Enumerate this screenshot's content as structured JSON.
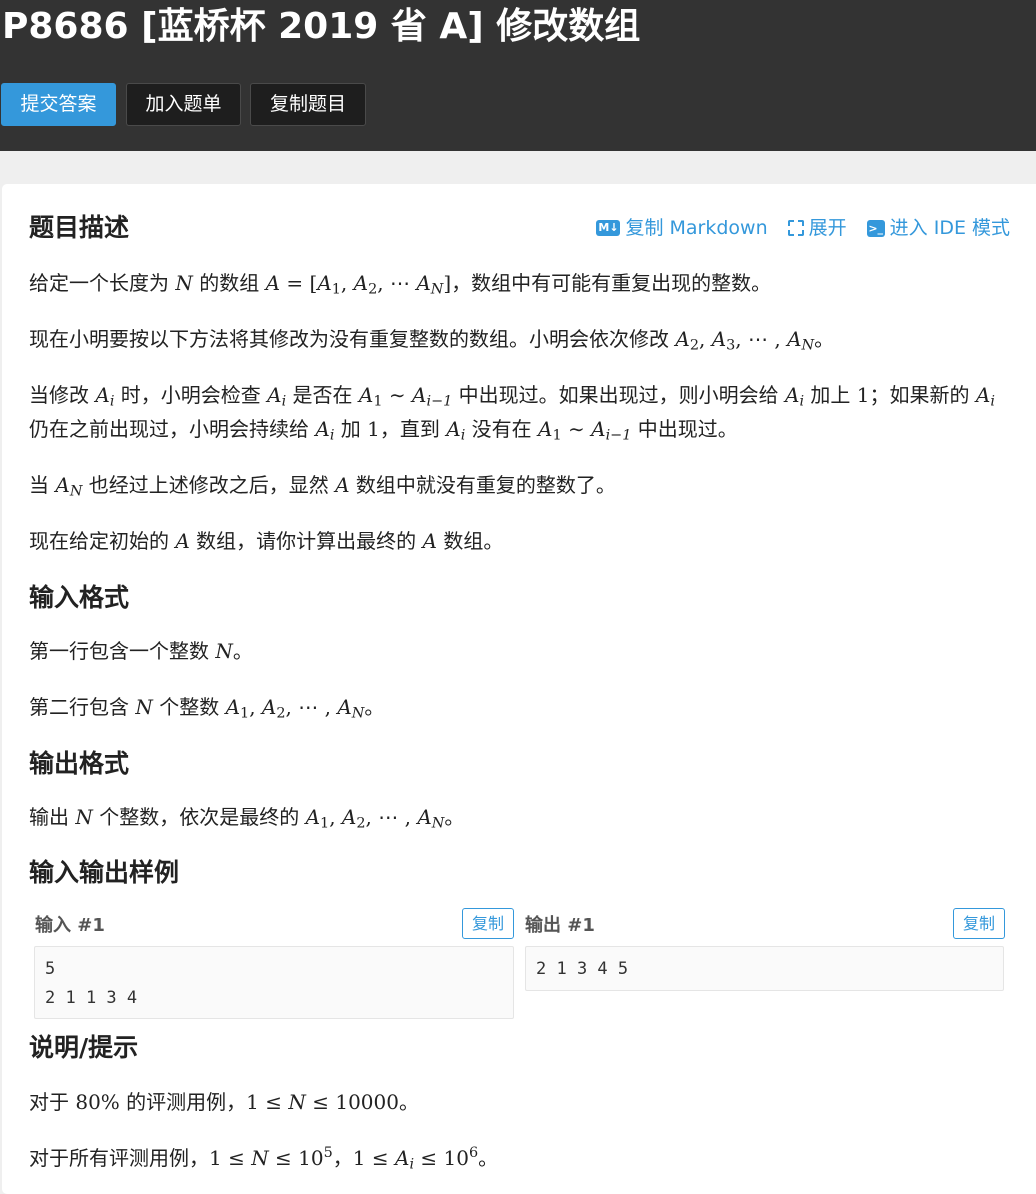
{
  "header": {
    "title": "P8686 [蓝桥杯 2019 省 A] 修改数组",
    "buttons": {
      "submit": "提交答案",
      "add_list": "加入题单",
      "copy_problem": "复制题目"
    }
  },
  "tools": {
    "copy_markdown": "复制 Markdown",
    "expand": "展开",
    "ide_mode": "进入 IDE 模式",
    "md_badge": "M↓",
    "ide_badge": ">_"
  },
  "sections": {
    "description": "题目描述",
    "input_format": "输入格式",
    "output_format": "输出格式",
    "samples": "输入输出样例",
    "hints": "说明/提示"
  },
  "samples": {
    "input_label": "输入 #1",
    "output_label": "输出 #1",
    "copy": "复制",
    "input_text": "5\n2 1 1 3 4",
    "output_text": "2 1 3 4 5"
  },
  "text": {
    "d1a": "给定一个长度为 ",
    "d1b": " 的数组 ",
    "d1c": "，数组中有可能有重复出现的整数。",
    "d2a": "现在小明要按以下方法将其修改为没有重复整数的数组。小明会依次修改 ",
    "d2b": "。",
    "d3a": "当修改 ",
    "d3b": " 时，小明会检查 ",
    "d3c": " 是否在 ",
    "d3d": " 中出现过。如果出现过，则小明会给 ",
    "d3e": " 加上 ",
    "d3f": "；如果新的 ",
    "d3g": " 仍在之前出现过，小明会持续给 ",
    "d3h": " 加 ",
    "d3i": "，直到 ",
    "d3j": " 没有在 ",
    "d3k": " 中出现过。",
    "d4a": "当 ",
    "d4b": " 也经过上述修改之后，显然 ",
    "d4c": " 数组中就没有重复的整数了。",
    "d5a": "现在给定初始的 ",
    "d5b": " 数组，请你计算出最终的 ",
    "d5c": " 数组。",
    "i1a": "第一行包含一个整数 ",
    "i1b": "。",
    "i2a": "第二行包含 ",
    "i2b": " 个整数 ",
    "i2c": "。",
    "o1a": "输出 ",
    "o1b": " 个整数，依次是最终的 ",
    "o1c": "。",
    "h1a": "对于 ",
    "h1b": " 的评测用例，",
    "h1c": "。",
    "h2a": "对于所有评测用例，",
    "h2b": "，",
    "h2c": "。"
  }
}
